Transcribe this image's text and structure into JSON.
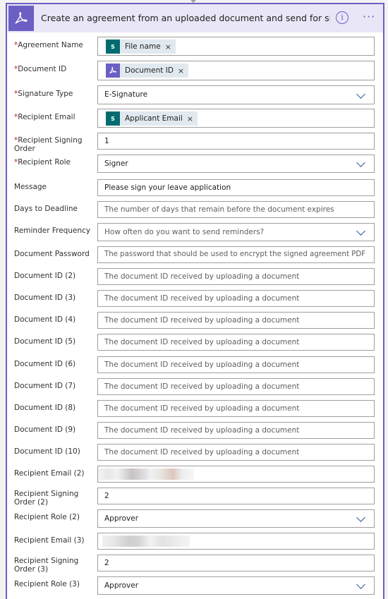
{
  "header": {
    "title": "Create an agreement from an uploaded document and send for signatu...",
    "info_icon": "i",
    "more_icon": "···"
  },
  "icons": {
    "app": "adobe-sign-icon",
    "sharepoint": "sharepoint-icon",
    "chevron": "chevron-down-icon"
  },
  "colors": {
    "accent": "#6b5fc4",
    "required": "#a4262c",
    "sharepoint": "#036c70",
    "token_bg": "#e1e9ef"
  },
  "required_mark": "*",
  "token_remove": "×",
  "fields": {
    "agreement_name": {
      "label": "Agreement Name",
      "token": "File name",
      "token_icon_text": "S"
    },
    "document_id": {
      "label": "Document ID",
      "token": "Document ID"
    },
    "signature_type": {
      "label": "Signature Type",
      "value": "E-Signature"
    },
    "recipient_email": {
      "label": "Recipient Email",
      "token": "Applicant Email",
      "token_icon_text": "S"
    },
    "recipient_signing_order": {
      "label": "Recipient Signing Order",
      "value": "1"
    },
    "recipient_role": {
      "label": "Recipient Role",
      "value": "Signer"
    },
    "message": {
      "label": "Message",
      "value": "Please sign your leave application"
    },
    "days_to_deadline": {
      "label": "Days to Deadline",
      "placeholder": "The number of days that remain before the document expires"
    },
    "reminder_frequency": {
      "label": "Reminder Frequency",
      "placeholder": "How often do you want to send reminders?"
    },
    "document_password": {
      "label": "Document Password",
      "placeholder": "The password that should be used to encrypt the signed agreement PDF"
    },
    "document_ids": [
      {
        "label": "Document ID (2)",
        "placeholder": "The document ID received by uploading a document"
      },
      {
        "label": "Document ID (3)",
        "placeholder": "The document ID received by uploading a document"
      },
      {
        "label": "Document ID (4)",
        "placeholder": "The document ID received by uploading a document"
      },
      {
        "label": "Document ID (5)",
        "placeholder": "The document ID received by uploading a document"
      },
      {
        "label": "Document ID (6)",
        "placeholder": "The document ID received by uploading a document"
      },
      {
        "label": "Document ID (7)",
        "placeholder": "The document ID received by uploading a document"
      },
      {
        "label": "Document ID (8)",
        "placeholder": "The document ID received by uploading a document"
      },
      {
        "label": "Document ID (9)",
        "placeholder": "The document ID received by uploading a document"
      },
      {
        "label": "Document ID (10)",
        "placeholder": "The document ID received by uploading a document"
      }
    ],
    "recipient_email_2": {
      "label": "Recipient Email (2)"
    },
    "recipient_signing_order_2": {
      "label": "Recipient Signing Order (2)",
      "value": "2"
    },
    "recipient_role_2": {
      "label": "Recipient Role (2)",
      "value": "Approver"
    },
    "recipient_email_3": {
      "label": "Recipient Email (3)"
    },
    "recipient_signing_order_3": {
      "label": "Recipient Signing Order (3)",
      "value": "2"
    },
    "recipient_role_3": {
      "label": "Recipient Role (3)",
      "value": "Approver"
    }
  }
}
